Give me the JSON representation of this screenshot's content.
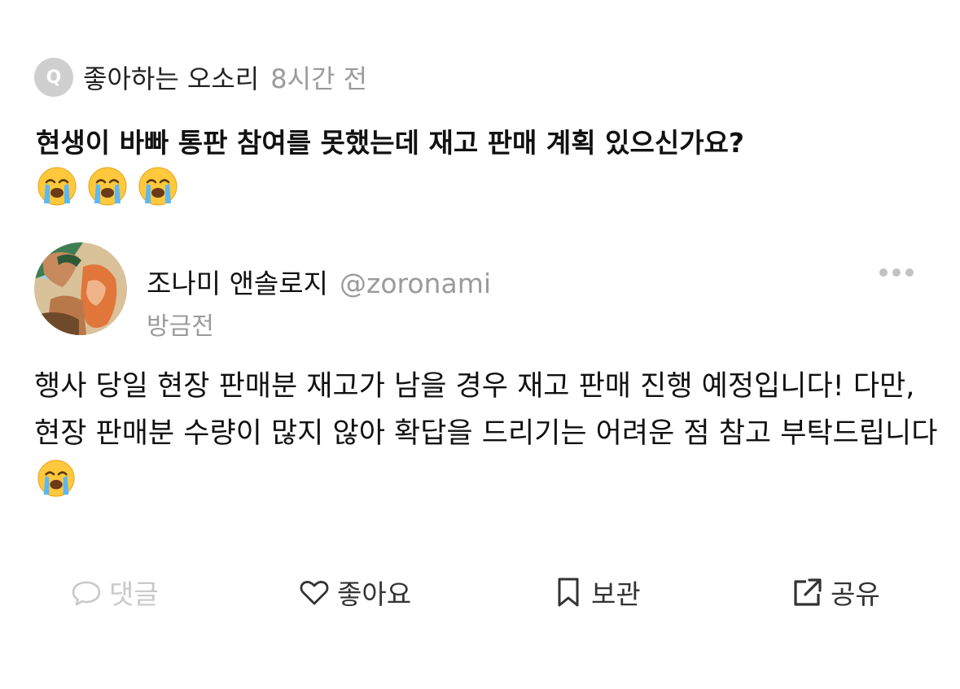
{
  "asker": {
    "badge": "Q",
    "name": "좋아하는 오소리",
    "time": "8시간 전"
  },
  "question": {
    "text": "현생이 바빠 통판 참여를 못했는데 재고 판매 계획 있으신가요?",
    "emoji_count": 3,
    "emoji_icon": "loudly-crying-face-icon"
  },
  "answerer": {
    "name": "조나미 앤솔로지",
    "handle": "@zoronami",
    "time": "방금전"
  },
  "answer": {
    "text": "행사 당일 현장 판매분 재고가 남을 경우 재고 판매 진행 예정입니다! 다만, 현장 판매분 수량이 많지 않아 확답을 드리기는 어려운 점 참고 부탁드립니다",
    "trailing_emoji": "loudly-crying-face-icon"
  },
  "actions": [
    {
      "label": "댓글",
      "icon": "speech-bubble-icon",
      "enabled": false
    },
    {
      "label": "좋아요",
      "icon": "heart-icon",
      "enabled": true
    },
    {
      "label": "보관",
      "icon": "bookmark-icon",
      "enabled": true
    },
    {
      "label": "공유",
      "icon": "share-icon",
      "enabled": true
    }
  ],
  "colors": {
    "muted": "#9b9b9b",
    "disabled": "#c9c9c9",
    "badge": "#cfcfcf",
    "text": "#111111"
  }
}
